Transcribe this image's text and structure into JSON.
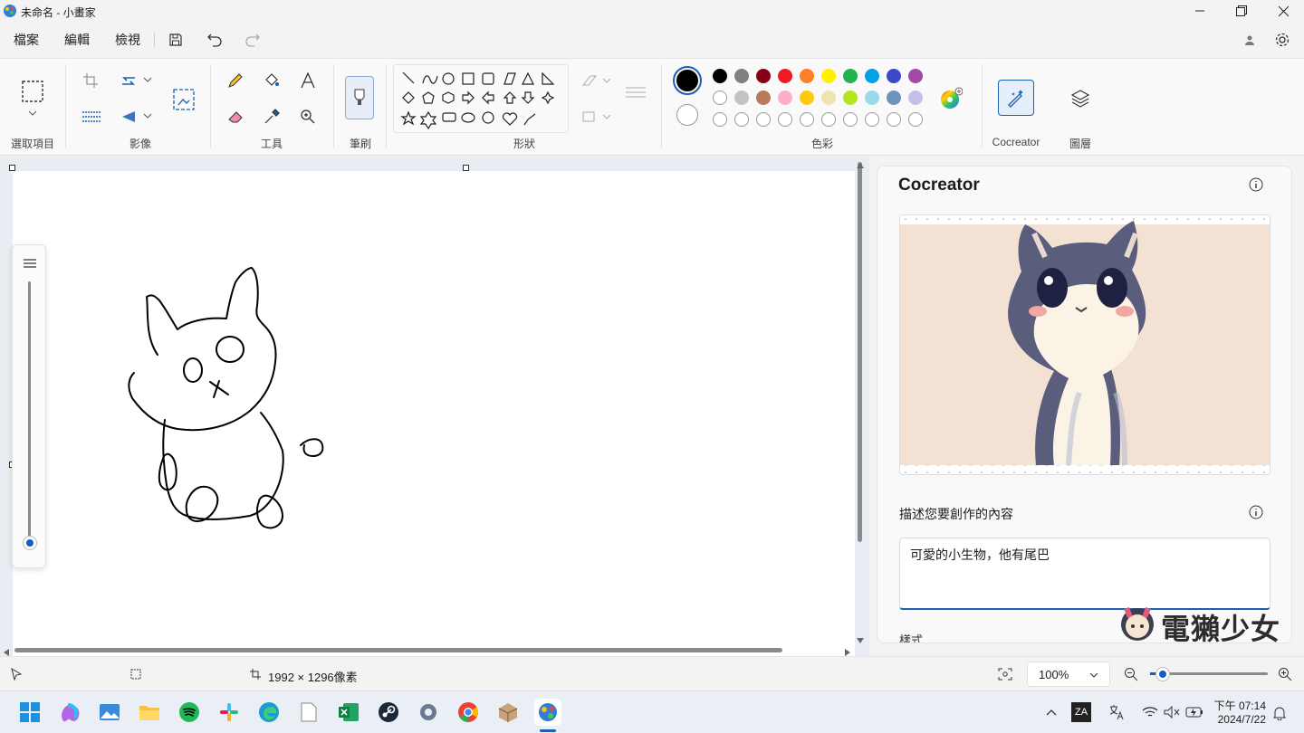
{
  "window": {
    "title": "未命名 - 小畫家"
  },
  "menubar": {
    "file": "檔案",
    "edit": "編輯",
    "view": "檢視"
  },
  "ribbon": {
    "groups": {
      "selection": "選取項目",
      "image": "影像",
      "tools": "工具",
      "brushes": "筆刷",
      "shapes": "形狀",
      "colors": "色彩",
      "cocreator": "Cocreator",
      "layers": "圖層"
    },
    "colors": {
      "primary": "#000000",
      "secondary": "#ffffff",
      "row1": [
        "#000000",
        "#7f7f7f",
        "#880015",
        "#ed1c24",
        "#ff7f27",
        "#fff200",
        "#22b14c",
        "#00a2e8",
        "#3f48cc",
        "#a349a4"
      ],
      "row2": [
        "#ffffff",
        "#c3c3c3",
        "#b97a57",
        "#ffaec9",
        "#ffc90e",
        "#efe4b0",
        "#b5e61d",
        "#99d9ea",
        "#7092be",
        "#c8bfe7"
      ]
    }
  },
  "cocreator": {
    "title": "Cocreator",
    "prompt_label": "描述您要創作的內容",
    "prompt_value": "可愛的小生物，他有尾巴",
    "style_label": "樣式"
  },
  "status": {
    "canvas_size": "1992 × 1296像素",
    "zoom": "100%"
  },
  "taskbar": {
    "time": "下午 07:14",
    "date": "2024/7/22"
  },
  "watermark": {
    "text": "電獺少女"
  }
}
